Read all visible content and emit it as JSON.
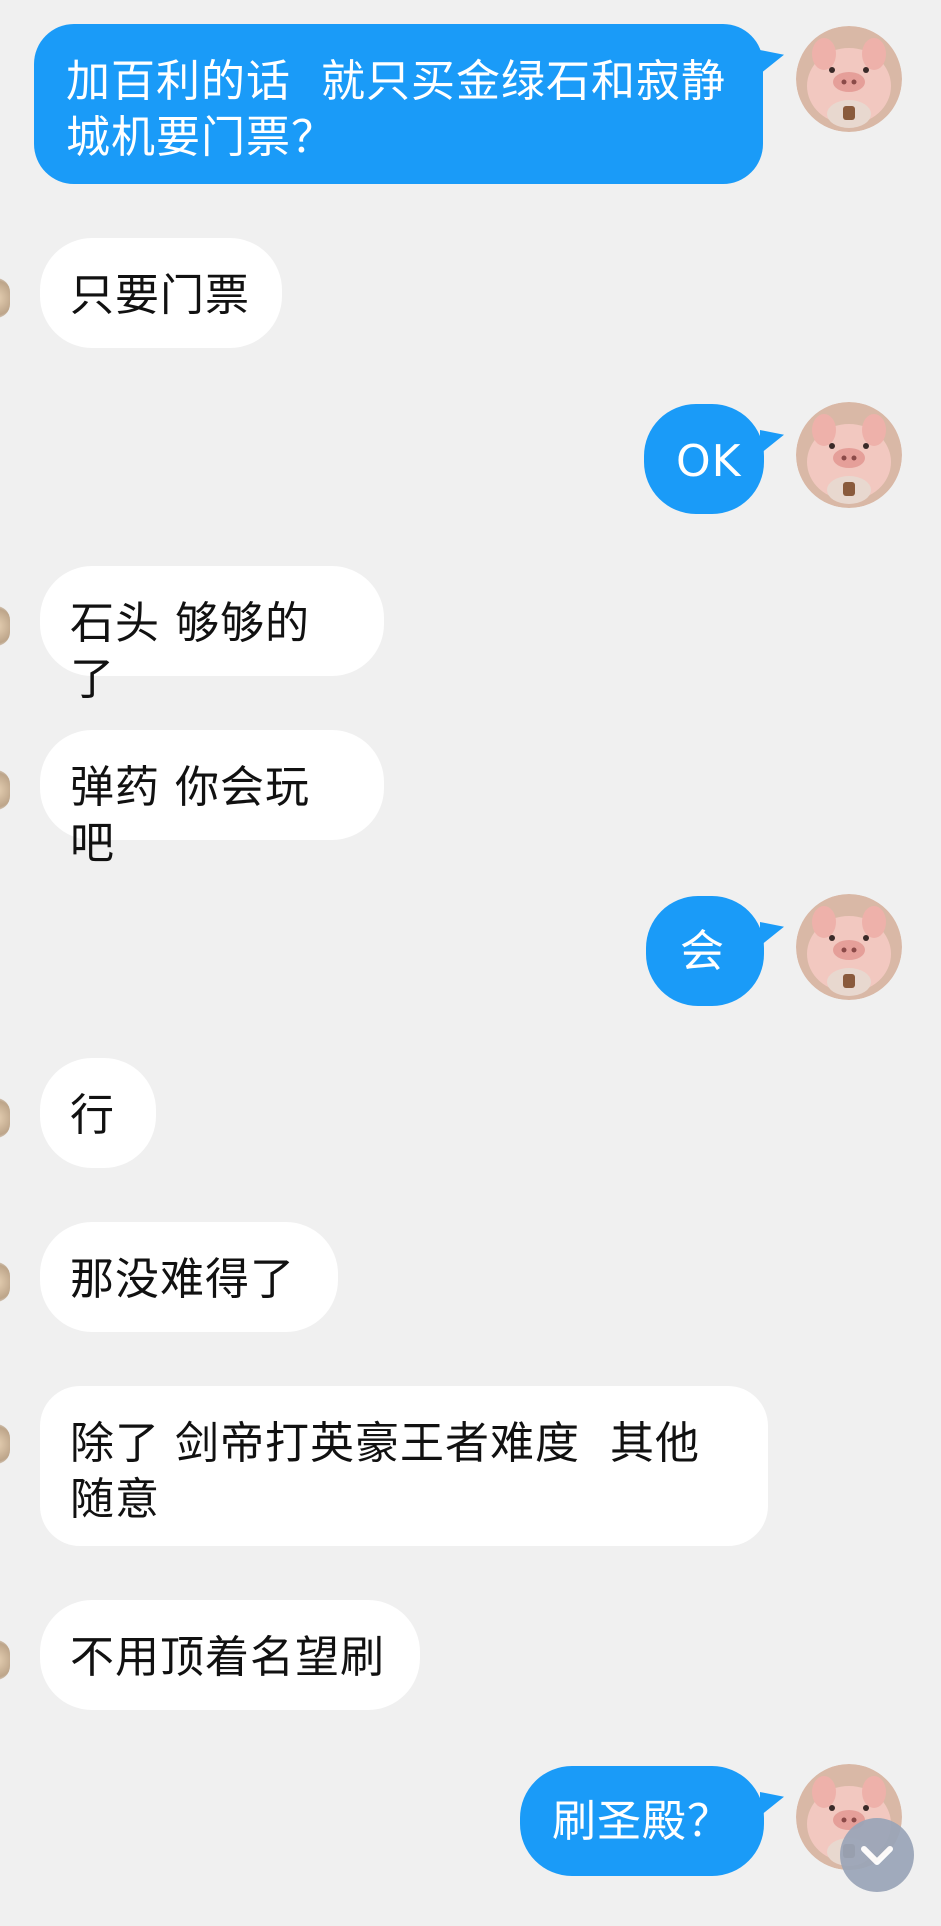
{
  "conversation": {
    "messages": [
      {
        "side": "out",
        "text": "加百利的话  就只买金绿石和寂静\n城机要门票？"
      },
      {
        "side": "in",
        "text": "只要门票"
      },
      {
        "side": "out",
        "text": "OK"
      },
      {
        "side": "in",
        "text": "石头 够够的了"
      },
      {
        "side": "in",
        "text": "弹药 你会玩吧"
      },
      {
        "side": "out",
        "text": "会"
      },
      {
        "side": "in",
        "text": "行"
      },
      {
        "side": "in",
        "text": "那没难得了"
      },
      {
        "side": "in",
        "text": "除了 剑帝打英豪王者难度  其他\n随意"
      },
      {
        "side": "in",
        "text": "不用顶着名望刷"
      },
      {
        "side": "out",
        "text": "刷圣殿？"
      }
    ]
  },
  "icons": {
    "self_avatar": "pig-avatar-icon",
    "scroll_down": "chevron-down-icon"
  },
  "colors": {
    "background": "#f0f0f0",
    "outgoing_bubble": "#1a9bf8",
    "incoming_bubble": "#ffffff",
    "scroll_button": "#9aa5b8"
  }
}
